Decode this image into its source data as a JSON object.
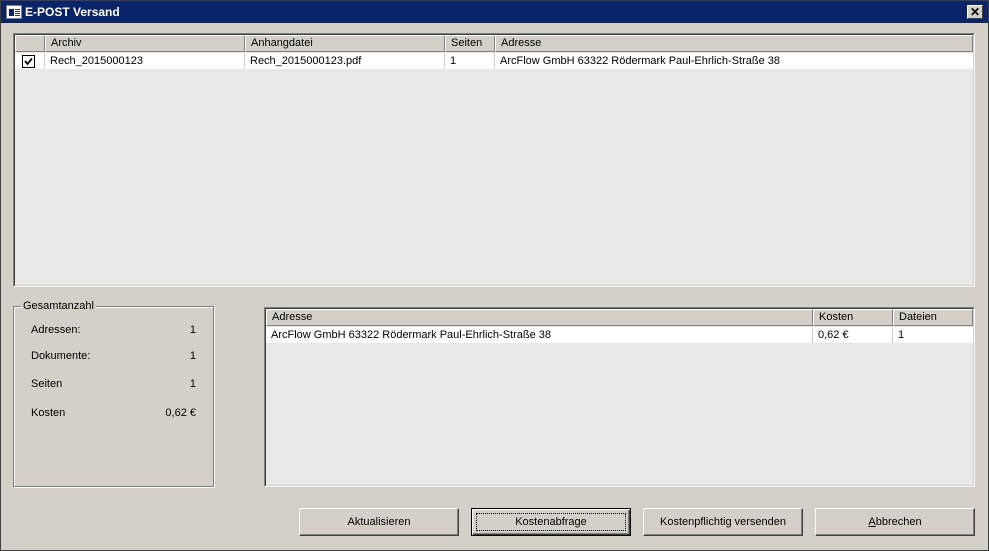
{
  "window": {
    "title": "E-POST Versand",
    "icon": "window-app-icon",
    "close_glyph": "✕"
  },
  "documents_table": {
    "columns": [
      "",
      "Archiv",
      "Anhangdatei",
      "Seiten",
      "Adresse"
    ],
    "rows": [
      {
        "checked": true,
        "archiv": "Rech_2015000123",
        "anhangdatei": "Rech_2015000123.pdf",
        "seiten": "1",
        "adresse": "ArcFlow GmbH 63322 Rödermark Paul-Ehrlich-Straße 38"
      }
    ]
  },
  "summary": {
    "title": "Gesamtanzahl",
    "items": [
      {
        "label": "Adressen:",
        "value": "1"
      },
      {
        "label": "Dokumente:",
        "value": "1"
      },
      {
        "label": "Seiten",
        "value": "1"
      },
      {
        "label": "Kosten",
        "value": "0,62 €"
      }
    ]
  },
  "cost_table": {
    "columns": [
      "Adresse",
      "Kosten",
      "Dateien"
    ],
    "rows": [
      {
        "adresse": "ArcFlow GmbH 63322 Rödermark Paul-Ehrlich-Straße 38",
        "kosten": "0,62 €",
        "dateien": "1"
      }
    ]
  },
  "buttons": {
    "refresh": "Aktualisieren",
    "cost_query": "Kostenabfrage",
    "send": "Kostenpflichtig versenden",
    "cancel_accel": "A",
    "cancel_rest": "bbrechen"
  }
}
